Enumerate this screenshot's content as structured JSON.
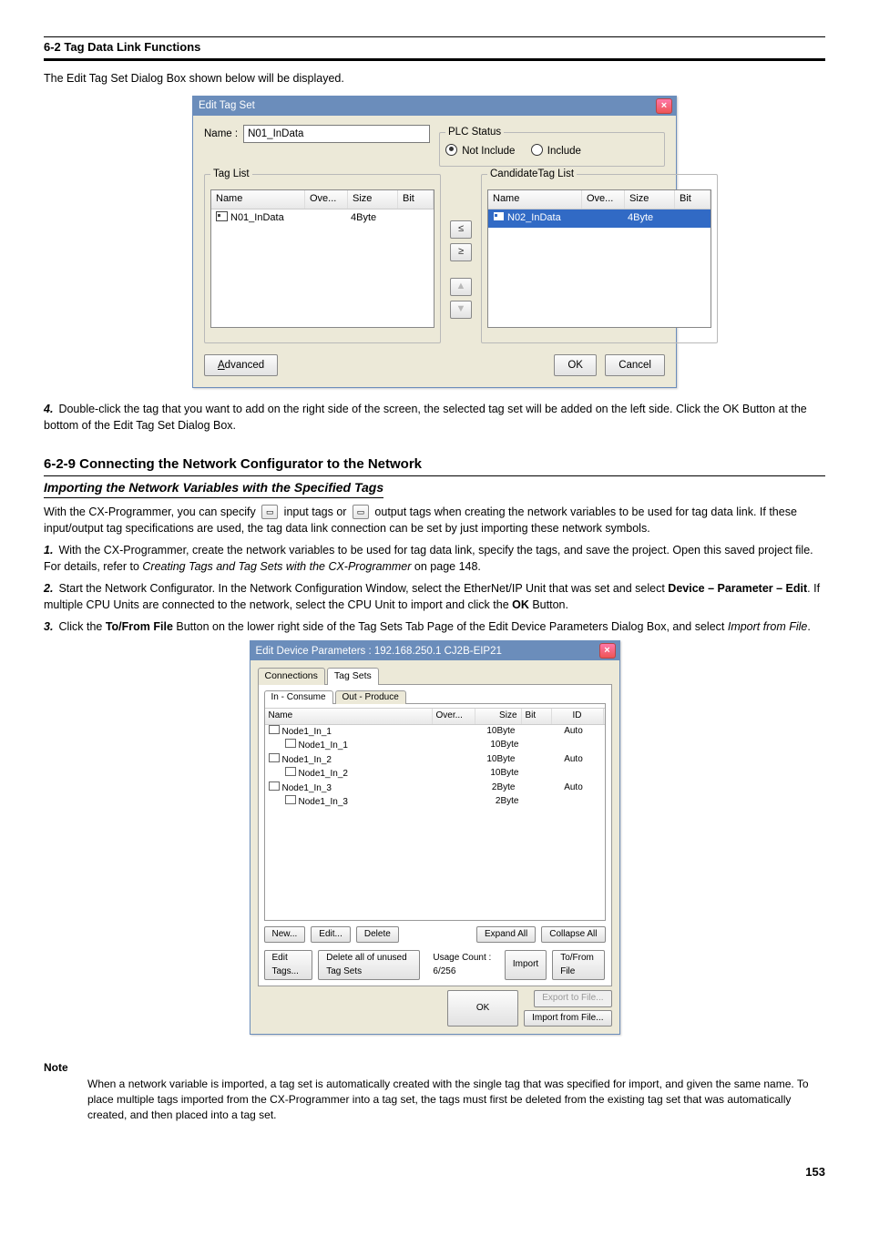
{
  "header": "6-2 Tag Data Link Functions",
  "caption1": "The Edit Tag Set Dialog Box shown below will be displayed.",
  "dlg1": {
    "title": "Edit Tag Set",
    "nameLabel": "Name :",
    "nameValue": "N01_InData",
    "plcGroup": "PLC Status",
    "notInclude": "Not Include",
    "include": "Include",
    "tagListLegend": "Tag List",
    "candListLegend": "CandidateTag List",
    "cols": {
      "name": "Name",
      "ove": "Ove...",
      "size": "Size",
      "bit": "Bit"
    },
    "leftRow": {
      "name": "N01_InData",
      "size": "4Byte"
    },
    "rightRow": {
      "name": "N02_InData",
      "size": "4Byte"
    },
    "advanced": "Advanced",
    "ok": "OK",
    "cancel": "Cancel"
  },
  "step4": {
    "num": "4.",
    "text": "Double-click the tag that you want to add on the right side of the screen, the selected tag set will be added on the left side. Click the OK Button at the bottom of the Edit Tag Set Dialog Box."
  },
  "sectionTitle": "6-2-9 Connecting the Network Configurator to the Network",
  "subTitle": "Importing the Network Variables with the Specified Tags",
  "para": {
    "p1a": "With the CX-Programmer, create the network variables to be used for tag data link, specify the tags, and save the project. Open this saved project file. For details, refer to ",
    "p1link": "Creating Tags and Tag Sets with the CX-Programmer",
    "p1b": " on page 148.",
    "p2a": "Start the Network Configurator. In the Network Configuration Window, select the EtherNet/IP Unit that was set and select ",
    "p2b": "Device – Parameter – Edit",
    "p2c": ". If multiple CPU Units are connected to the network, select the CPU Unit to import and click the ",
    "p2d": "OK",
    "p2e": " Button."
  },
  "step3": {
    "num": "3.",
    "textA": "Click the ",
    "textB": "To/From File",
    "textC": " Button on the lower right side of the Tag Sets Tab Page of the Edit Device Parameters Dialog Box, and select ",
    "textD": "Import from File",
    "textE": "."
  },
  "dlg2": {
    "title": "Edit Device Parameters : 192.168.250.1 CJ2B-EIP21",
    "tabConnections": "Connections",
    "tabTagSets": "Tag Sets",
    "tabIn": "In - Consume",
    "tabOut": "Out - Produce",
    "cols": {
      "name": "Name",
      "ove": "Over...",
      "size": "Size",
      "bit": "Bit",
      "id": "ID"
    },
    "rows": [
      {
        "name": "Node1_In_1",
        "size": "10Byte",
        "id": "Auto",
        "type": "tagset"
      },
      {
        "name": "Node1_In_1",
        "size": "10Byte",
        "id": "",
        "type": "tag"
      },
      {
        "name": "Node1_In_2",
        "size": "10Byte",
        "id": "Auto",
        "type": "tagset"
      },
      {
        "name": "Node1_In_2",
        "size": "10Byte",
        "id": "",
        "type": "tag"
      },
      {
        "name": "Node1_In_3",
        "size": "2Byte",
        "id": "Auto",
        "type": "tagset"
      },
      {
        "name": "Node1_In_3",
        "size": "2Byte",
        "id": "",
        "type": "tag"
      }
    ],
    "btnNew": "New...",
    "btnEdit": "Edit...",
    "btnDelete": "Delete",
    "btnExpand": "Expand All",
    "btnCollapse": "Collapse All",
    "btnEditTags": "Edit Tags...",
    "btnDeleteUnused": "Delete all of unused Tag Sets",
    "usage": "Usage Count :   6/256",
    "btnImport": "Import",
    "btnToFrom": "To/From File",
    "btnExportFile": "Export to File...",
    "btnImportFile": "Import from File...",
    "okBtn": "OK"
  },
  "note": {
    "label": "Note",
    "text": "When a network variable is imported, a tag set is automatically created with the single tag that was specified for import, and given the same name. To place multiple tags imported from the CX-Programmer into a tag set, the tags must first be deleted from the existing tag set that was automatically created, and then placed into a tag set."
  },
  "pageNum": "153"
}
